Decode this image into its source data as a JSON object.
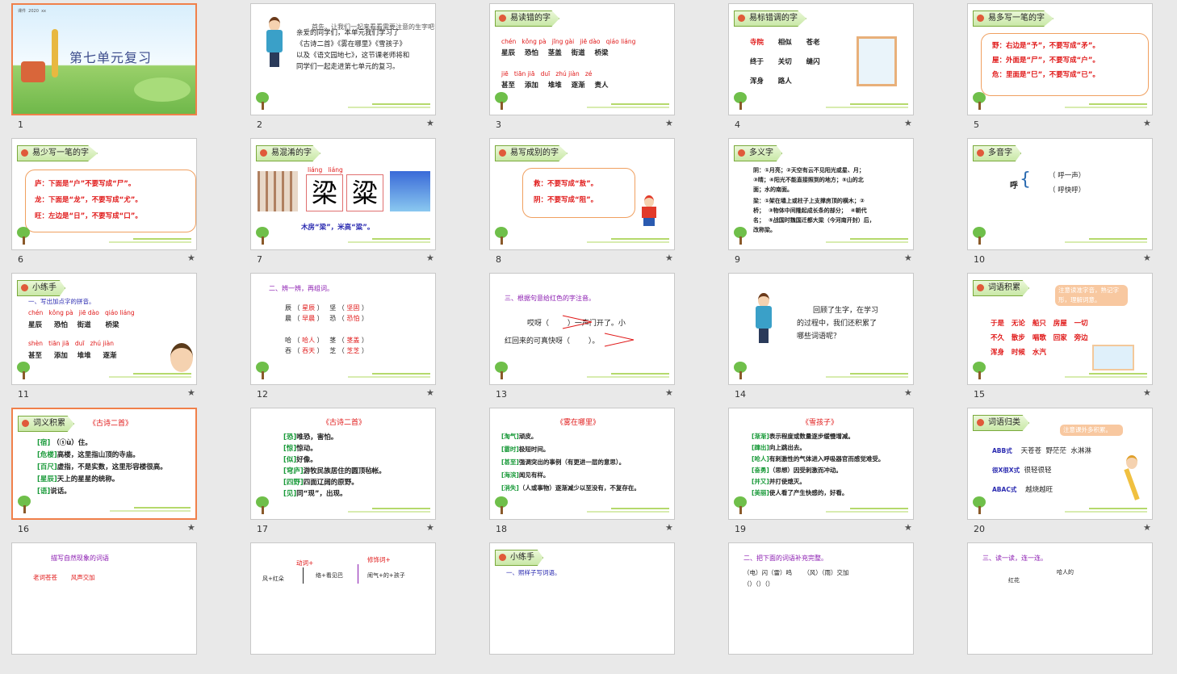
{
  "slides": [
    {
      "num": "1",
      "title": "第七单元复习",
      "top_text": "课件  2020  xx"
    },
    {
      "num": "2",
      "intro_lines": [
        "亲爱的同学们，本单元我们学习了",
        "《古诗二首》《雾在哪里》《雪孩子》",
        "以及《语文园地七》，这节课老师将和",
        "同学们一起走进第七单元的复习。"
      ],
      "overlap_text": "首先，让我们一起来看看需要注意的生字吧！"
    },
    {
      "num": "3",
      "tag": "易读错的字",
      "pinyin1": "chén   kǒng pà   jīng gài   jiē dào   qiáo liáng",
      "words1": [
        "星辰",
        "恐怕",
        "茎盖",
        "街道",
        "桥梁"
      ],
      "pinyin2": "jiē   tiān jiā   duī   zhú jiàn   zé",
      "words2": [
        "甚至",
        "添加",
        "堆堆",
        "逐渐",
        "责人"
      ]
    },
    {
      "num": "4",
      "tag": "易标错调的字",
      "rows": [
        [
          "寺院",
          "相似",
          "苍老"
        ],
        [
          "终于",
          "关切",
          "缝闪"
        ],
        [
          "浑身",
          "路人"
        ]
      ]
    },
    {
      "num": "5",
      "tag": "易多写一笔的字",
      "lines": [
        "野：右边是“予”，不要写成“矛”。",
        "屋：外面是“尸”，不要写成“户”。",
        "危：里面是“巳”，不要写成“已”。"
      ]
    },
    {
      "num": "6",
      "tag": "易少写一笔的字",
      "lines": [
        "庐：下面是“户”不要写成“尸”。",
        "龙：下面是“龙”，不要写成“尤”。",
        "旺：左边是“日”，不要写成“口”。"
      ]
    },
    {
      "num": "7",
      "tag": "易混淆的字",
      "chars": [
        "梁",
        "粱"
      ],
      "pinyin": "liáng   liáng",
      "caption": "木房“梁”，米高“粱”。"
    },
    {
      "num": "8",
      "tag": "易写成别的字",
      "lines": [
        "救：不要写成“敖”。",
        "阴：不要写成“阻”。"
      ]
    },
    {
      "num": "9",
      "tag": "多义字",
      "lines": [
        "阴：①月亮；②天空有云不见阳光或星、月；",
        "③晴；④阳光不能直接照到的地方；⑤山的北",
        "面；水的南面。",
        "梁：①架在墙上或柱子上支撑房顶的横木；②",
        "桥；  ③物体中间隆起成长条的部分；  ④朝代",
        "名；  ⑤战国时魏国迁都大梁（今河南开封）后，",
        "改称梁。"
      ]
    },
    {
      "num": "10",
      "tag": "多音字",
      "char": "呼",
      "readings": [
        "（ 呼一声）",
        "（ 呼快呼）"
      ]
    },
    {
      "num": "11",
      "tag": "小练手",
      "instruction": "一、写出加点字的拼音。",
      "pinyin1": "chén   kǒng pà   jiē dào   qiáo liáng",
      "words1": [
        "星辰",
        "恐怕",
        "街道",
        "桥梁"
      ],
      "pinyin2": "shèn   tiān jiā   duī   zhú jiàn",
      "words2": [
        "甚至",
        "添加",
        "堆堆",
        "逐渐"
      ]
    },
    {
      "num": "12",
      "heading": "二、辨一辨，再组词。",
      "pairs": [
        [
          "辰",
          "星辰",
          "坚",
          "坚固"
        ],
        [
          "晨",
          "早晨",
          "恐",
          "恐怕"
        ],
        [
          "哈",
          "哈人",
          "茎",
          "茎盖"
        ],
        [
          "吞",
          "吞天",
          "芝",
          "芝芝"
        ]
      ]
    },
    {
      "num": "13",
      "heading": "三、根据句意给红色的字注音。",
      "line1": "哎呀（        ）一声门开了。小",
      "line2": "红回来的可真快呀（        ）。"
    },
    {
      "num": "14",
      "lines": [
        "回顾了生字，在学习",
        "的过程中，我们还积累了",
        "哪些词语呢？"
      ]
    },
    {
      "num": "15",
      "tag": "词语积累",
      "note": "注意读准字音，熟记字形，理解词意。",
      "rows": [
        [
          "于是",
          "无论",
          "船只",
          "房屋",
          "一切"
        ],
        [
          "不久",
          "散步",
          "唱歌",
          "回家",
          "旁边"
        ],
        [
          "浑身",
          "时候",
          "水汽"
        ]
      ]
    },
    {
      "num": "16",
      "tag": "词义积累",
      "subtitle": "《古诗二首》",
      "lines": [
        [
          "[宿]",
          "（ⓢù）住。"
        ],
        [
          "[危楼]",
          "高楼，这里指山顶的寺庙。"
        ],
        [
          "[百尺]",
          "虚指，不是实数，这里形容楼很高。"
        ],
        [
          "[星辰]",
          "天上的星星的统称。"
        ],
        [
          "[语]",
          "说话。"
        ]
      ]
    },
    {
      "num": "17",
      "subtitle": "《古诗二首》",
      "lines": [
        [
          "[恐]",
          "唯恐，害怕。"
        ],
        [
          "[惊]",
          "惊动。"
        ],
        [
          "[似]",
          "好像。"
        ],
        [
          "[穹庐]",
          "游牧民族居住的圆顶毡帐。"
        ],
        [
          "[四野]",
          "四面辽阔的原野。"
        ],
        [
          "[见]",
          "同“现”，出现。"
        ]
      ]
    },
    {
      "num": "18",
      "subtitle": "《雾在哪里》",
      "lines": [
        [
          "[淘气]",
          "顽皮。"
        ],
        [
          "[霎时]",
          "极短时间。"
        ],
        [
          "[甚至]",
          "强调突出的事例（有更进一层的意思）。"
        ],
        [
          "[海滨]",
          "闻见有样。"
        ],
        [
          "[消失]",
          "（人或事物）逐渐减少以至没有，不复存在。"
        ]
      ]
    },
    {
      "num": "19",
      "subtitle": "《雪孩子》",
      "lines": [
        [
          "[渐渐]",
          "表示程度或数量逐步缓慢增减。"
        ],
        [
          "[蹿出]",
          "向上跳出去。"
        ],
        [
          "[呛人]",
          "有刺激性的气体进入呼吸器官而感觉难受。"
        ],
        [
          "[奋勇]",
          "（思想）因受刺激而冲动。"
        ],
        [
          "[并又]",
          "并打使熄灭。"
        ],
        [
          "[美丽]",
          "使人看了产生快感的，好看。"
        ]
      ]
    },
    {
      "num": "20",
      "tag": "词语归类",
      "note": "注意课外多积累。",
      "rows": [
        [
          "ABB式",
          "天苍苍  野茫茫  水淋淋"
        ],
        [
          "很X很X式",
          "很轻很轻"
        ],
        [
          "ABAC式",
          "越烧越旺"
        ]
      ]
    },
    {
      "num": "21",
      "heading": "描写自然现象的词语",
      "items": [
        "老词苍苍",
        "风声交加"
      ]
    },
    {
      "num": "22",
      "cols": [
        "动词+",
        "修饰词+"
      ],
      "rows": [
        [
          "风+红朵",
          "络+看见巴",
          "闹气+的+孩子"
        ]
      ]
    },
    {
      "num": "23",
      "tag": "小练手",
      "instruction": "一、照样子写词语。"
    },
    {
      "num": "24",
      "heading": "二、把下面的词语补充完整。",
      "items": [
        "（电）闪（雷）鸣",
        "（风）（雨）交加",
        "（）（）（）"
      ]
    },
    {
      "num": "25",
      "heading": "三、读一读，连一连。",
      "items": [
        "哈人的",
        "红花"
      ]
    }
  ]
}
